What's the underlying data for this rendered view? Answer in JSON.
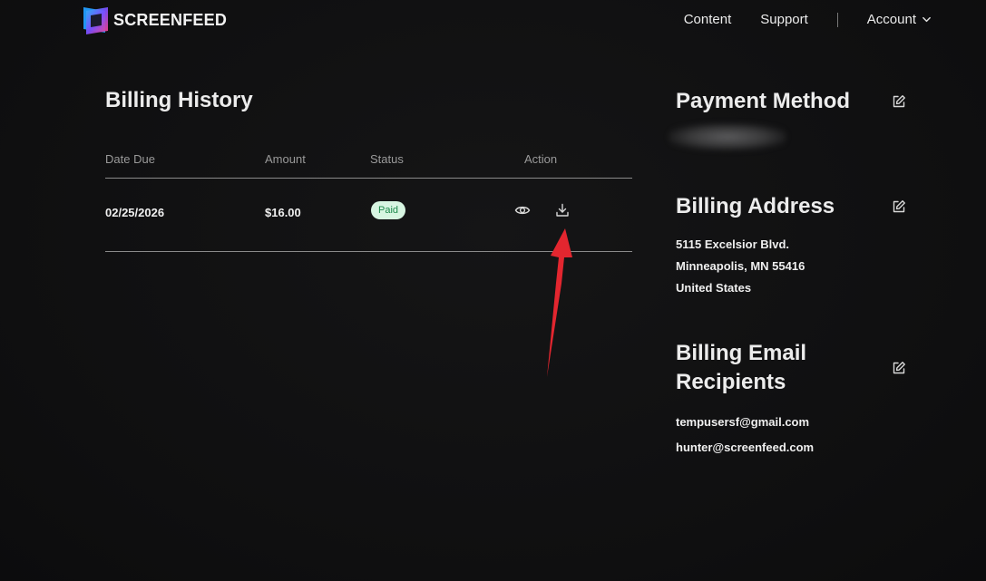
{
  "header": {
    "brand": "SCREENFEED",
    "nav": {
      "content": "Content",
      "support": "Support",
      "account": "Account"
    }
  },
  "billing_history": {
    "title": "Billing History",
    "columns": {
      "date": "Date Due",
      "amount": "Amount",
      "status": "Status",
      "action": "Action"
    },
    "rows": [
      {
        "date": "02/25/2026",
        "amount": "$16.00",
        "status": "Paid"
      }
    ]
  },
  "payment_method": {
    "title": "Payment Method"
  },
  "billing_address": {
    "title": "Billing Address",
    "line1": "5115 Excelsior Blvd.",
    "line2": "Minneapolis, MN 55416",
    "line3": "United States"
  },
  "billing_email": {
    "title": "Billing Email Recipients",
    "emails": [
      "tempusersf@gmail.com",
      "hunter@screenfeed.com"
    ]
  },
  "colors": {
    "background": "#111113",
    "badge_bg": "#d7f5e1",
    "badge_text": "#1f8a4c",
    "annotation": "#e3262f"
  },
  "icons": {
    "view": "eye-icon",
    "download": "download-icon",
    "edit": "edit-icon",
    "account_dropdown": "chevron-down-icon"
  }
}
